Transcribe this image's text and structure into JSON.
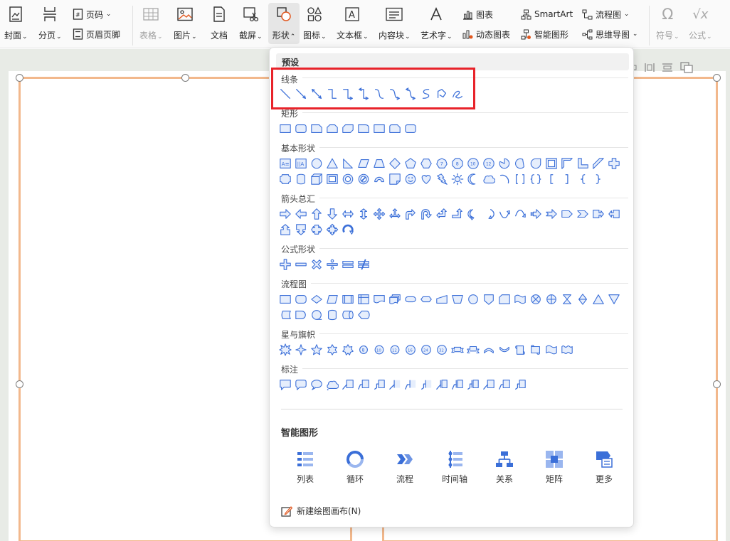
{
  "ribbon": {
    "cover": "封面",
    "pagebreak": "分页",
    "page_number": "页码",
    "header_footer": "页眉页脚",
    "table": "表格",
    "picture": "图片",
    "document": "文档",
    "screenshot": "截屏",
    "shape": "形状",
    "icon": "图标",
    "textbox": "文本框",
    "content_block": "内容块",
    "wordart": "艺术字",
    "chart": "图表",
    "dynamic_chart": "动态图表",
    "smartart": "SmartArt",
    "smart_graphic": "智能图形",
    "flowchart": "流程图",
    "mindmap": "思维导图",
    "symbol": "符号",
    "formula": "公式"
  },
  "panel": {
    "preset": "预设",
    "sections": {
      "lines": "线条",
      "rect": "矩形",
      "basic": "基本形状",
      "arrows": "箭头总汇",
      "formula": "公式形状",
      "flowchart": "流程图",
      "stars": "星与旗帜",
      "callout": "标注"
    },
    "smart_title": "智能图形",
    "smart_items": [
      "列表",
      "循环",
      "流程",
      "时间轴",
      "关系",
      "矩阵",
      "更多"
    ],
    "new_canvas": "新建绘图画布(N)"
  },
  "colors": {
    "accent": "#3b6fd8",
    "highlight": "#e8232a",
    "selection": "#f2b88c"
  }
}
